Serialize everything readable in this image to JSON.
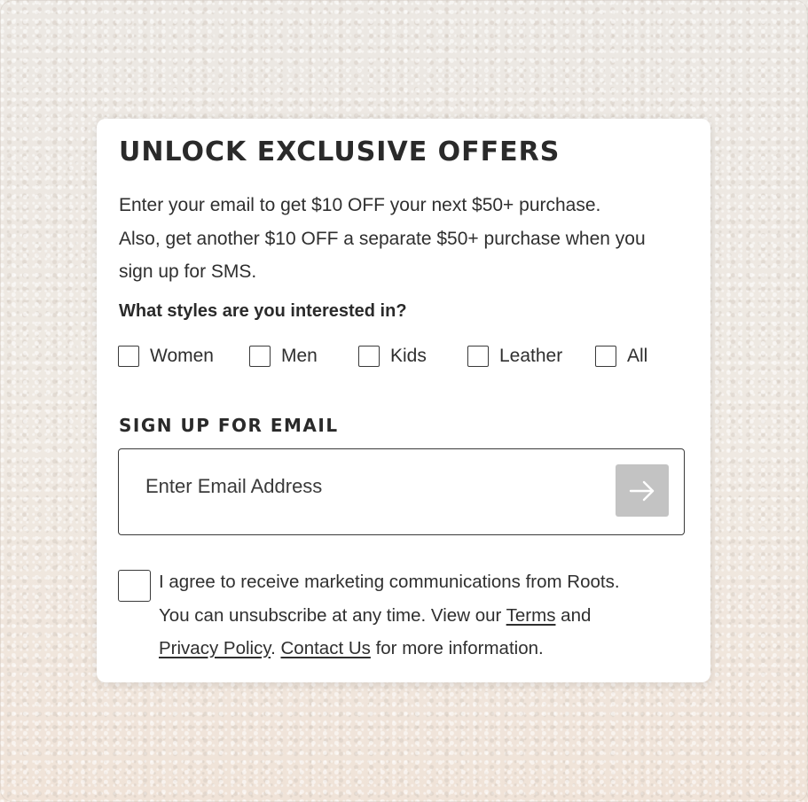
{
  "popup": {
    "title": "UNLOCK EXCLUSIVE OFFERS",
    "description_lines": [
      "Enter your email to get $10 OFF your next $50+ purchase.",
      "Also, get another $10 OFF a separate $50+ purchase when you",
      "sign up for SMS."
    ],
    "styles_question": "What styles are you interested in?",
    "style_options": [
      {
        "label": "Women",
        "checked": false
      },
      {
        "label": "Men",
        "checked": false
      },
      {
        "label": "Kids",
        "checked": false
      },
      {
        "label": "Leather",
        "checked": false
      },
      {
        "label": "All",
        "checked": false
      }
    ],
    "email_heading": "SIGN UP FOR EMAIL",
    "email_input": {
      "placeholder": "Enter Email Address",
      "value": ""
    },
    "submit_icon": "arrow-right-icon",
    "consent": {
      "checked": false,
      "line1": "I agree to receive marketing communications from Roots.",
      "line2_prefix": "You can unsubscribe at any time. View our ",
      "terms_link": "Terms",
      "line2_suffix": " and",
      "privacy_link": "Privacy Policy",
      "separator": ". ",
      "contact_link": "Contact Us",
      "line3_suffix": " for more information."
    }
  },
  "colors": {
    "card_background": "#ffffff",
    "text": "#2f2f2f",
    "submit_button": "#c3c3c3",
    "page_background": "#f1ebe4"
  }
}
